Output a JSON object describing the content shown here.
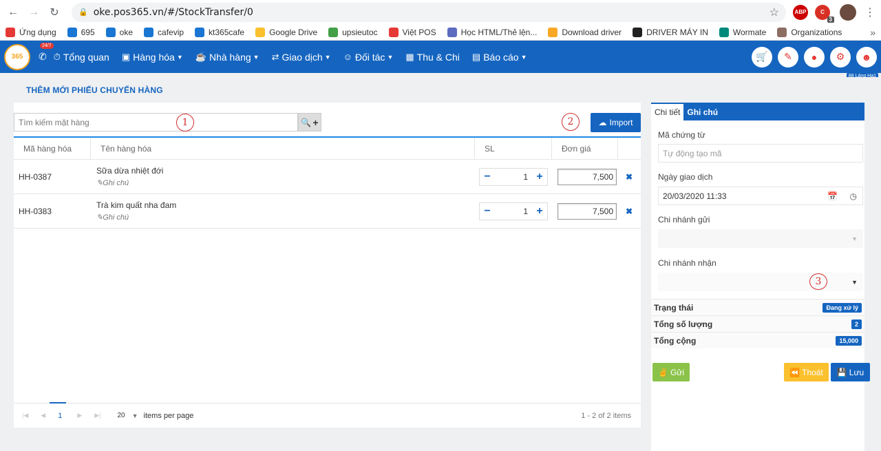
{
  "browser": {
    "url": "oke.pos365.vn/#/StockTransfer/0",
    "ext_badge": "3",
    "bookmarks": [
      {
        "label": "Ứng dụng",
        "color": "#e53935"
      },
      {
        "label": "695",
        "color": "#1976d2"
      },
      {
        "label": "oke",
        "color": "#1976d2"
      },
      {
        "label": "cafevip",
        "color": "#1976d2"
      },
      {
        "label": "kt365cafe",
        "color": "#1976d2"
      },
      {
        "label": "Google Drive",
        "color": "#fbc02d"
      },
      {
        "label": "upsieutoc",
        "color": "#43a047"
      },
      {
        "label": "Việt POS",
        "color": "#e53935"
      },
      {
        "label": "Học HTML/Thẻ lện...",
        "color": "#5c6bc0"
      },
      {
        "label": "Download driver",
        "color": "#f9a825"
      },
      {
        "label": "DRIVER MÁY IN",
        "color": "#212121"
      },
      {
        "label": "Wormate",
        "color": "#00897b"
      },
      {
        "label": "Organizations",
        "color": "#8d6e63"
      }
    ]
  },
  "header": {
    "badge": "24/7",
    "menu": [
      "Tổng quan",
      "Hàng hóa",
      "Nhà hàng",
      "Giao dịch",
      "Đối tác",
      "Thu & Chi",
      "Báo cáo"
    ],
    "branch": "88 Láng Hạ1"
  },
  "page": {
    "title": "THÊM MỚI PHIẾU CHUYỂN HÀNG",
    "search_placeholder": "Tìm kiếm mặt hàng",
    "import_label": "Import",
    "callouts": [
      "1",
      "2",
      "3"
    ]
  },
  "grid": {
    "columns": [
      "Mã hàng hóa",
      "Tên hàng hóa",
      "SL",
      "Đơn giá"
    ],
    "rows": [
      {
        "code": "HH-0387",
        "name": "Sữa dừa nhiệt đới",
        "note": "Ghi chú",
        "qty": "1",
        "price": "7,500"
      },
      {
        "code": "HH-0383",
        "name": "Trà kim quất nha đam",
        "note": "Ghi chú",
        "qty": "1",
        "price": "7,500"
      }
    ]
  },
  "pager": {
    "current": "1",
    "page_size": "20",
    "per_page_label": "items per page",
    "info": "1 - 2 of 2 items"
  },
  "details": {
    "tabs": [
      "Chi tiết",
      "Ghi chú"
    ],
    "doc_code_label": "Mã chứng từ",
    "doc_code_placeholder": "Tự động tạo mã",
    "date_label": "Ngày giao dịch",
    "date_value": "20/03/2020 11:33",
    "from_branch_label": "Chi nhánh gửi",
    "to_branch_label": "Chi nhánh nhận",
    "status_label": "Trạng thái",
    "status_value": "Đang xử lý",
    "total_qty_label": "Tổng số lượng",
    "total_qty_value": "2",
    "total_label": "Tổng cộng",
    "total_value": "15,000"
  },
  "actions": {
    "send": "Gửi",
    "exit": "Thoát",
    "save": "Lưu"
  }
}
